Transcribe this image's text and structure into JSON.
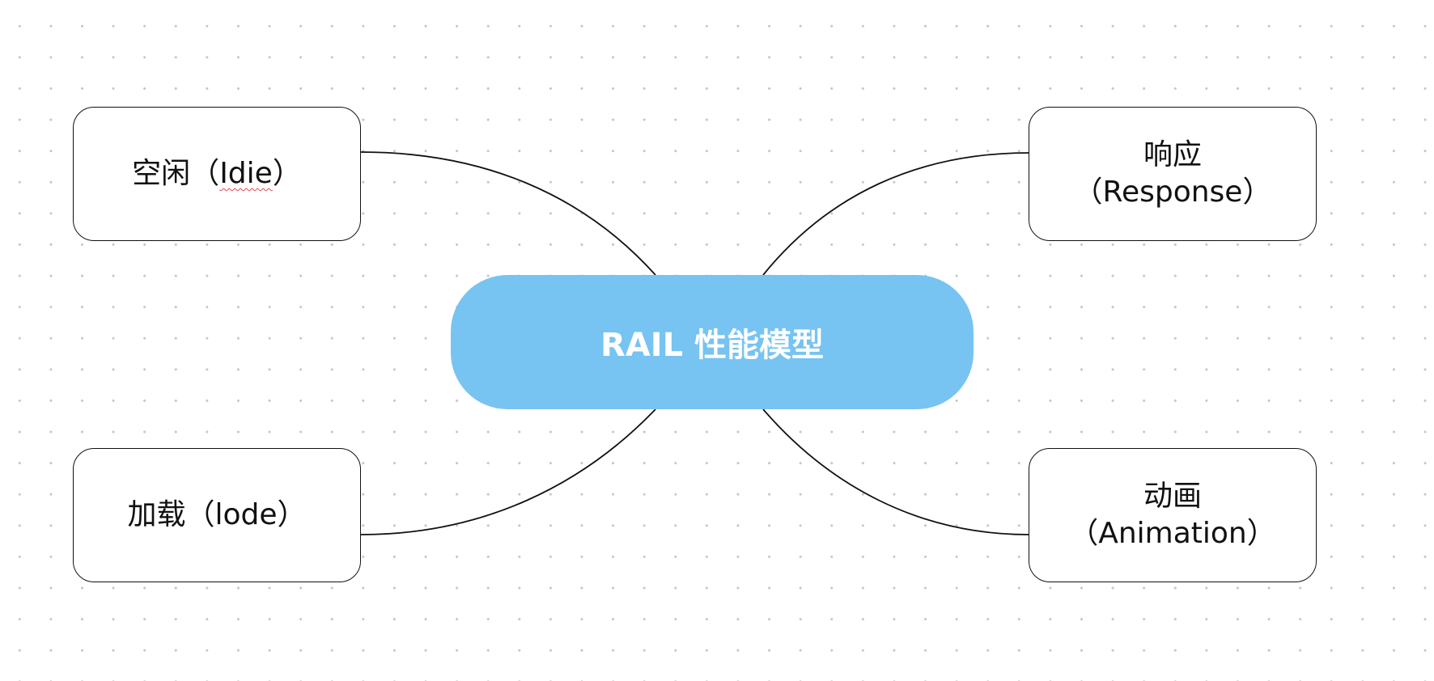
{
  "diagram": {
    "center": {
      "label": "RAIL 性能模型",
      "color": "#77c3f1"
    },
    "nodes": {
      "idle": {
        "prefix": "空闲（",
        "term": "Idie",
        "suffix": "）"
      },
      "response": {
        "line1": "响应",
        "line2": "（Response）"
      },
      "load": {
        "label": "加载（lode）"
      },
      "animation": {
        "line1": "动画",
        "line2": "（Animation）"
      }
    }
  }
}
